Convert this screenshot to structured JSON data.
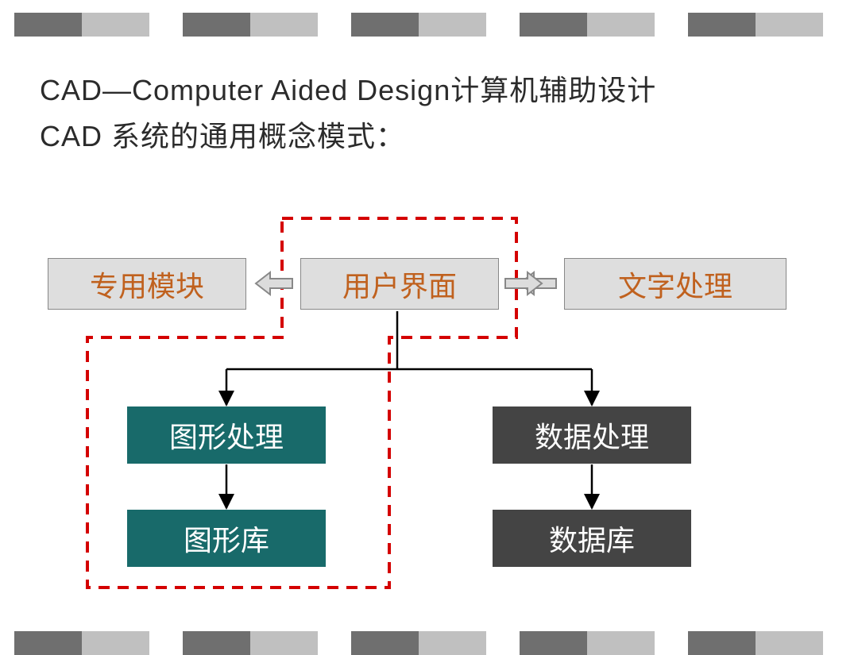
{
  "title_line1": "CAD—Computer Aided Design计算机辅助设计",
  "title_line2": "CAD 系统的通用概念模式：",
  "boxes": {
    "special_module": "专用模块",
    "user_interface": "用户界面",
    "text_processing": "文字处理",
    "graphic_processing": "图形处理",
    "data_processing": "数据处理",
    "graphic_library": "图形库",
    "database": "数据库"
  },
  "colors": {
    "accent_text": "#c0611e",
    "teal": "#186a6a",
    "dark": "#444444",
    "edge_dark": "#6f6f6f",
    "edge_light": "#c0c0c0",
    "dashed": "#d40000"
  },
  "diagram": {
    "type": "hierarchy",
    "root": "用户界面",
    "siblings": [
      "专用模块",
      "文字处理"
    ],
    "children": [
      {
        "node": "图形处理",
        "child": "图形库"
      },
      {
        "node": "数据处理",
        "child": "数据库"
      }
    ],
    "highlighted_group": [
      "用户界面",
      "图形处理",
      "图形库"
    ]
  }
}
